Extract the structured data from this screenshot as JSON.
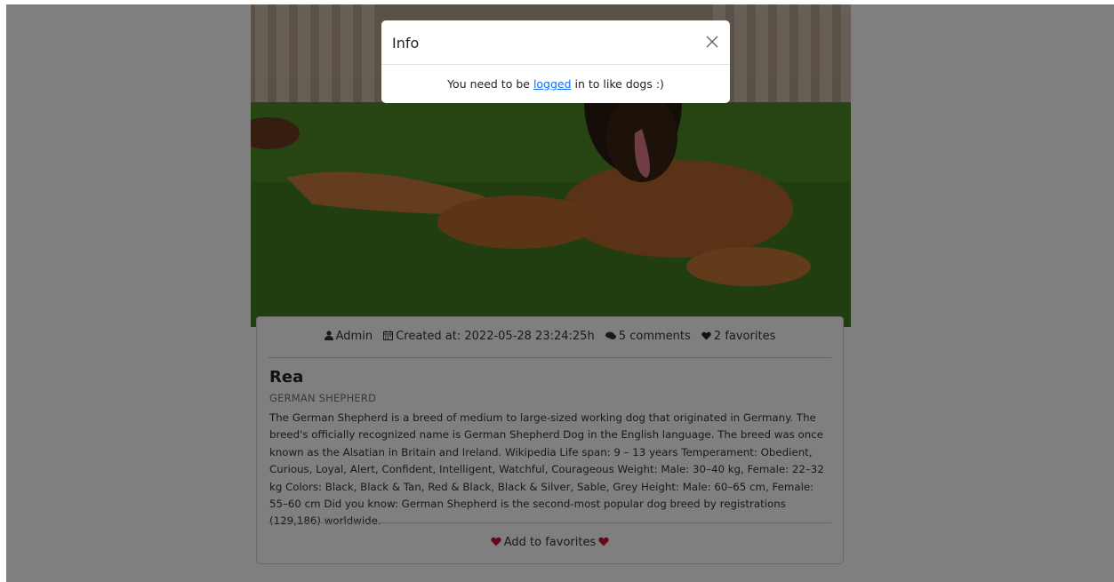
{
  "modal": {
    "title": "Info",
    "message_before": "You need to be ",
    "message_link": "logged",
    "message_after": " in to like dogs :)"
  },
  "meta": {
    "author": "Admin",
    "created": "Created at: 2022-05-28 23:24:25h",
    "comments": "5 comments",
    "favorites": "2 favorites"
  },
  "dog": {
    "name": "Rea",
    "breed": "GERMAN SHEPHERD",
    "description": "The German Shepherd is a breed of medium to large-sized working dog that originated in Germany. The breed's officially recognized name is German Shepherd Dog in the English language. The breed was once known as the Alsatian in Britain and Ireland. Wikipedia Life span: 9 – 13 years Temperament: Obedient, Curious, Loyal, Alert, Confident, Intelligent, Watchful, Courageous Weight: Male: 30–40 kg, Female: 22–32 kg Colors: Black, Black & Tan, Red & Black, Black & Silver, Sable, Grey Height: Male: 60–65 cm, Female: 55–60 cm Did you know: German Shepherd is the second-most popular dog breed by registrations (129,186) worldwide."
  },
  "actions": {
    "add_favorite": "Add to favorites"
  },
  "colors": {
    "heart": "#c8102e",
    "link": "#0d6efd",
    "backdrop": "rgba(0,0,0,0.5)"
  },
  "icons": [
    "user-icon",
    "calendar-icon",
    "comments-icon",
    "heart-icon",
    "close-icon"
  ]
}
